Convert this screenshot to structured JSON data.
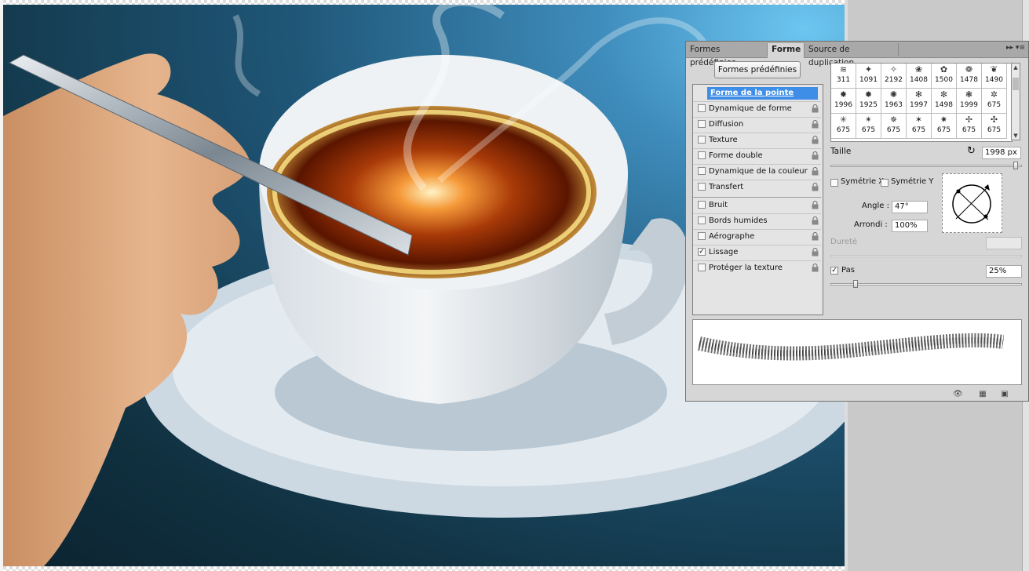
{
  "tabs": [
    "Formes prédéfinies",
    "Forme",
    "Source de duplication"
  ],
  "presets_button": "Formes prédéfinies",
  "options": [
    {
      "label": "Forme de la pointe",
      "checked": false,
      "heading": true
    },
    {
      "label": "Dynamique de forme",
      "checked": false
    },
    {
      "label": "Diffusion",
      "checked": false
    },
    {
      "label": "Texture",
      "checked": false
    },
    {
      "label": "Forme double",
      "checked": false
    },
    {
      "label": "Dynamique de la couleur",
      "checked": false
    },
    {
      "label": "Transfert",
      "checked": false
    },
    {
      "label": "Bruit",
      "checked": false
    },
    {
      "label": "Bords humides",
      "checked": false
    },
    {
      "label": "Aérographe",
      "checked": false
    },
    {
      "label": "Lissage",
      "checked": true
    },
    {
      "label": "Protéger la texture",
      "checked": false
    }
  ],
  "brush_tips": [
    "311",
    "1091",
    "2192",
    "1408",
    "1500",
    "1478",
    "1490",
    "1996",
    "1925",
    "1963",
    "1997",
    "1498",
    "1999",
    "675",
    "675",
    "675",
    "675",
    "675",
    "675",
    "675",
    "675"
  ],
  "size_label": "Taille",
  "size_value": "1998 px",
  "flip_x": "Symétrie X",
  "flip_y": "Symétrie Y",
  "angle_label": "Angle :",
  "angle_value": "47°",
  "roundness_label": "Arrondi :",
  "roundness_value": "100%",
  "hardness_label": "Dureté",
  "spacing_label": "Pas",
  "spacing_value": "25%",
  "spacing_checked": true,
  "size_level": 0.98,
  "spacing_level": 0.12
}
